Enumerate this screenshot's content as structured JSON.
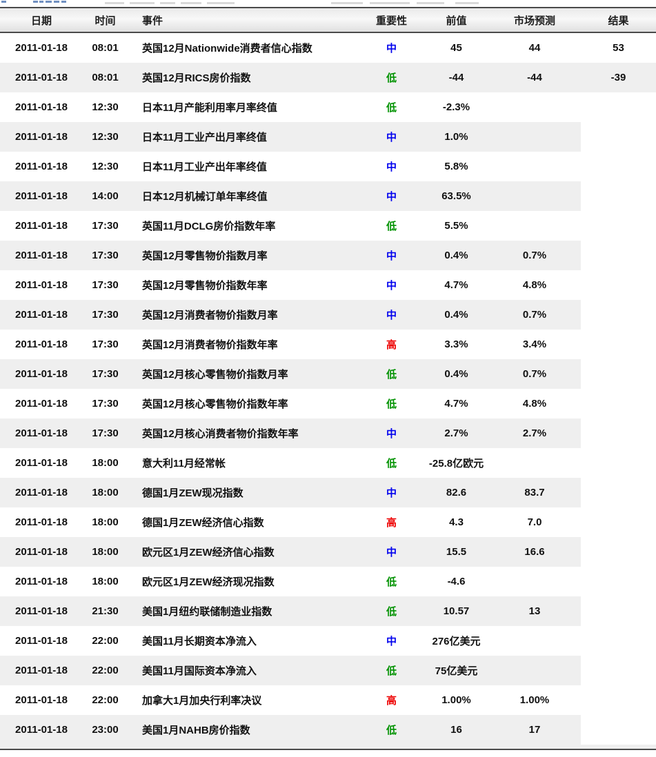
{
  "page": {
    "description_note": "economic calendar data table",
    "date_shown": "2011-01-18"
  },
  "colors": {
    "importance_high": "#ee0000",
    "importance_medium": "#0000ee",
    "importance_low": "#009200",
    "row_alt_bg": "#efefef",
    "border_dark": "#4a4a4a"
  },
  "importance_levels": {
    "高": "high",
    "中": "medium",
    "低": "low"
  },
  "table": {
    "headers": [
      "日期",
      "时间",
      "事件",
      "重要性",
      "前值",
      "市场预测",
      "结果"
    ],
    "rows": [
      {
        "date": "2011-01-18",
        "time": "08:01",
        "event": "英国12月Nationwide消费者信心指数",
        "importance": "中",
        "prev": "45",
        "forecast": "44",
        "result": "53"
      },
      {
        "date": "2011-01-18",
        "time": "08:01",
        "event": "英国12月RICS房价指数",
        "importance": "低",
        "prev": "-44",
        "forecast": "-44",
        "result": "-39"
      },
      {
        "date": "2011-01-18",
        "time": "12:30",
        "event": "日本11月产能利用率月率终值",
        "importance": "低",
        "prev": "-2.3%",
        "forecast": "",
        "result": ""
      },
      {
        "date": "2011-01-18",
        "time": "12:30",
        "event": "日本11月工业产出月率终值",
        "importance": "中",
        "prev": "1.0%",
        "forecast": "",
        "result": ""
      },
      {
        "date": "2011-01-18",
        "time": "12:30",
        "event": "日本11月工业产出年率终值",
        "importance": "中",
        "prev": "5.8%",
        "forecast": "",
        "result": ""
      },
      {
        "date": "2011-01-18",
        "time": "14:00",
        "event": "日本12月机械订单年率终值",
        "importance": "中",
        "prev": "63.5%",
        "forecast": "",
        "result": ""
      },
      {
        "date": "2011-01-18",
        "time": "17:30",
        "event": "英国11月DCLG房价指数年率",
        "importance": "低",
        "prev": "5.5%",
        "forecast": "",
        "result": ""
      },
      {
        "date": "2011-01-18",
        "time": "17:30",
        "event": "英国12月零售物价指数月率",
        "importance": "中",
        "prev": "0.4%",
        "forecast": "0.7%",
        "result": ""
      },
      {
        "date": "2011-01-18",
        "time": "17:30",
        "event": "英国12月零售物价指数年率",
        "importance": "中",
        "prev": "4.7%",
        "forecast": "4.8%",
        "result": ""
      },
      {
        "date": "2011-01-18",
        "time": "17:30",
        "event": "英国12月消费者物价指数月率",
        "importance": "中",
        "prev": "0.4%",
        "forecast": "0.7%",
        "result": ""
      },
      {
        "date": "2011-01-18",
        "time": "17:30",
        "event": "英国12月消费者物价指数年率",
        "importance": "高",
        "prev": "3.3%",
        "forecast": "3.4%",
        "result": ""
      },
      {
        "date": "2011-01-18",
        "time": "17:30",
        "event": "英国12月核心零售物价指数月率",
        "importance": "低",
        "prev": "0.4%",
        "forecast": "0.7%",
        "result": ""
      },
      {
        "date": "2011-01-18",
        "time": "17:30",
        "event": "英国12月核心零售物价指数年率",
        "importance": "低",
        "prev": "4.7%",
        "forecast": "4.8%",
        "result": ""
      },
      {
        "date": "2011-01-18",
        "time": "17:30",
        "event": "英国12月核心消费者物价指数年率",
        "importance": "中",
        "prev": "2.7%",
        "forecast": "2.7%",
        "result": ""
      },
      {
        "date": "2011-01-18",
        "time": "18:00",
        "event": "意大利11月经常帐",
        "importance": "低",
        "prev": "-25.8亿欧元",
        "forecast": "",
        "result": ""
      },
      {
        "date": "2011-01-18",
        "time": "18:00",
        "event": "德国1月ZEW现况指数",
        "importance": "中",
        "prev": "82.6",
        "forecast": "83.7",
        "result": ""
      },
      {
        "date": "2011-01-18",
        "time": "18:00",
        "event": "德国1月ZEW经济信心指数",
        "importance": "高",
        "prev": "4.3",
        "forecast": "7.0",
        "result": ""
      },
      {
        "date": "2011-01-18",
        "time": "18:00",
        "event": "欧元区1月ZEW经济信心指数",
        "importance": "中",
        "prev": "15.5",
        "forecast": "16.6",
        "result": ""
      },
      {
        "date": "2011-01-18",
        "time": "18:00",
        "event": "欧元区1月ZEW经济现况指数",
        "importance": "低",
        "prev": "-4.6",
        "forecast": "",
        "result": ""
      },
      {
        "date": "2011-01-18",
        "time": "21:30",
        "event": "美国1月纽约联储制造业指数",
        "importance": "低",
        "prev": "10.57",
        "forecast": "13",
        "result": ""
      },
      {
        "date": "2011-01-18",
        "time": "22:00",
        "event": "美国11月长期资本净流入",
        "importance": "中",
        "prev": "276亿美元",
        "forecast": "",
        "result": ""
      },
      {
        "date": "2011-01-18",
        "time": "22:00",
        "event": "美国11月国际资本净流入",
        "importance": "低",
        "prev": "75亿美元",
        "forecast": "",
        "result": ""
      },
      {
        "date": "2011-01-18",
        "time": "22:00",
        "event": "加拿大1月加央行利率决议",
        "importance": "高",
        "prev": "1.00%",
        "forecast": "1.00%",
        "result": ""
      },
      {
        "date": "2011-01-18",
        "time": "23:00",
        "event": "美国1月NAHB房价指数",
        "importance": "低",
        "prev": "16",
        "forecast": "17",
        "result": ""
      }
    ]
  }
}
